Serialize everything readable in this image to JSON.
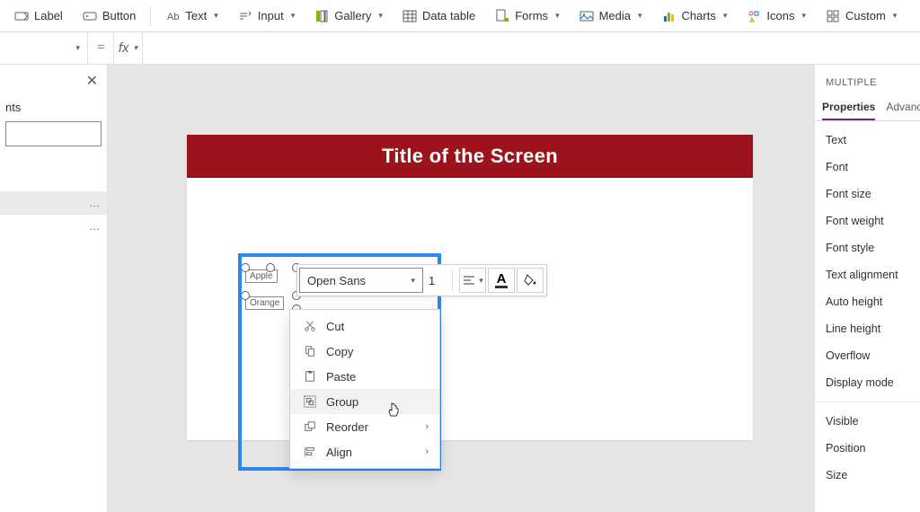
{
  "ribbon": {
    "items": [
      {
        "label": "Label",
        "has_dd": false
      },
      {
        "label": "Button",
        "has_dd": false
      },
      {
        "label": "Text",
        "has_dd": true
      },
      {
        "label": "Input",
        "has_dd": true
      },
      {
        "label": "Gallery",
        "has_dd": true
      },
      {
        "label": "Data table",
        "has_dd": false
      },
      {
        "label": "Forms",
        "has_dd": true
      },
      {
        "label": "Media",
        "has_dd": true
      },
      {
        "label": "Charts",
        "has_dd": true
      },
      {
        "label": "Icons",
        "has_dd": true
      },
      {
        "label": "Custom",
        "has_dd": true
      }
    ]
  },
  "fxbar": {
    "eq": "=",
    "fx": "fx"
  },
  "left_panel": {
    "title_fragment": "nts",
    "items": [
      "…",
      "…"
    ]
  },
  "canvas": {
    "screen_title": "Title of the Screen",
    "selected_labels": [
      "Apple",
      "Orange"
    ]
  },
  "float_toolbar": {
    "font": "Open Sans",
    "font_size_fragment": "1"
  },
  "context_menu": {
    "items": [
      {
        "label": "Cut",
        "icon": "cut-icon"
      },
      {
        "label": "Copy",
        "icon": "copy-icon"
      },
      {
        "label": "Paste",
        "icon": "paste-icon"
      },
      {
        "label": "Group",
        "icon": "group-icon",
        "hover": true
      },
      {
        "label": "Reorder",
        "icon": "reorder-icon",
        "sub": true
      },
      {
        "label": "Align",
        "icon": "align-icon",
        "sub": true
      }
    ]
  },
  "right_panel": {
    "header": "MULTIPLE",
    "tabs": {
      "active": "Properties",
      "other": "Advanc"
    },
    "rows_a": [
      "Text",
      "Font",
      "Font size",
      "Font weight",
      "Font style",
      "Text alignment",
      "Auto height",
      "Line height",
      "Overflow",
      "Display mode"
    ],
    "rows_b": [
      "Visible",
      "Position",
      "Size"
    ]
  },
  "colors": {
    "accent": "#9c131b",
    "selection": "#2b88f0",
    "tab_underline": "#742774"
  }
}
